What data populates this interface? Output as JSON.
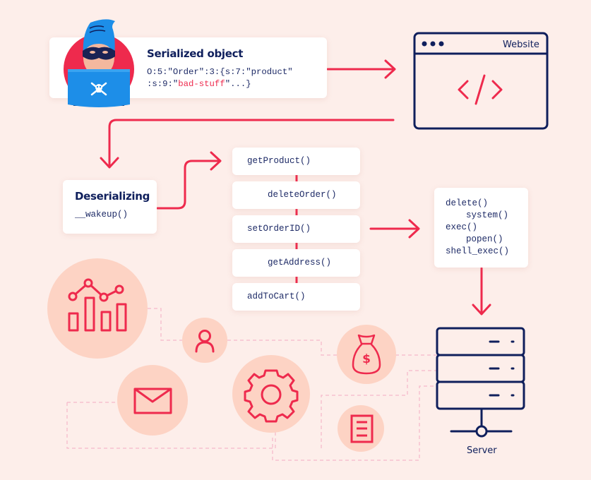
{
  "colors": {
    "background": "#fdeeea",
    "accent_red": "#ee2a4d",
    "navy": "#0f1f5c",
    "circle_fill": "#fdd3c4",
    "dashed_line": "#f6b7c9",
    "card_bg": "#ffffff"
  },
  "serialized": {
    "title": "Serialized object",
    "code_line1": "O:5:\"Order\":3:{s:7:\"product\"",
    "code_line2_prefix": ":s:9:\"",
    "code_line2_highlight": "bad-stuff",
    "code_line2_suffix": "\"...}",
    "avatar_icon": "hacker-icon",
    "laptop_icon": "skull-crossbones-icon"
  },
  "website": {
    "label": "Website",
    "icon": "code-brackets-icon"
  },
  "deserializing": {
    "title": "Deserializing",
    "code": "__wakeup()"
  },
  "methods": [
    {
      "label": "getProduct()",
      "indent": false
    },
    {
      "label": "deleteOrder()",
      "indent": true
    },
    {
      "label": "setOrderID()",
      "indent": false
    },
    {
      "label": "getAddress()",
      "indent": true
    },
    {
      "label": "addToCart()",
      "indent": false
    }
  ],
  "dangerous_functions": [
    {
      "label": "delete()",
      "indent": false
    },
    {
      "label": "system()",
      "indent": true
    },
    {
      "label": "exec()",
      "indent": false
    },
    {
      "label": "popen()",
      "indent": true
    },
    {
      "label": "shell_exec()",
      "indent": false
    }
  ],
  "server": {
    "label": "Server",
    "icon": "server-rack-icon"
  },
  "resource_icons": [
    "analytics-chart-icon",
    "user-icon",
    "mail-icon",
    "gear-icon",
    "money-bag-icon",
    "document-icon"
  ]
}
